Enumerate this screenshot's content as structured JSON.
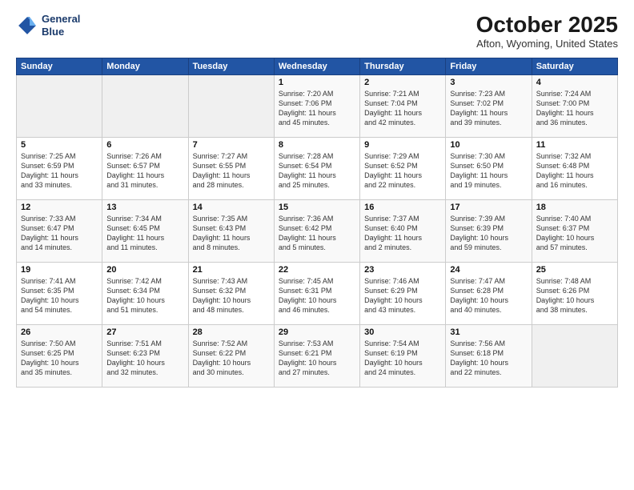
{
  "header": {
    "logo_line1": "General",
    "logo_line2": "Blue",
    "month": "October 2025",
    "location": "Afton, Wyoming, United States"
  },
  "weekdays": [
    "Sunday",
    "Monday",
    "Tuesday",
    "Wednesday",
    "Thursday",
    "Friday",
    "Saturday"
  ],
  "weeks": [
    [
      {
        "day": "",
        "info": ""
      },
      {
        "day": "",
        "info": ""
      },
      {
        "day": "",
        "info": ""
      },
      {
        "day": "1",
        "info": "Sunrise: 7:20 AM\nSunset: 7:06 PM\nDaylight: 11 hours\nand 45 minutes."
      },
      {
        "day": "2",
        "info": "Sunrise: 7:21 AM\nSunset: 7:04 PM\nDaylight: 11 hours\nand 42 minutes."
      },
      {
        "day": "3",
        "info": "Sunrise: 7:23 AM\nSunset: 7:02 PM\nDaylight: 11 hours\nand 39 minutes."
      },
      {
        "day": "4",
        "info": "Sunrise: 7:24 AM\nSunset: 7:00 PM\nDaylight: 11 hours\nand 36 minutes."
      }
    ],
    [
      {
        "day": "5",
        "info": "Sunrise: 7:25 AM\nSunset: 6:59 PM\nDaylight: 11 hours\nand 33 minutes."
      },
      {
        "day": "6",
        "info": "Sunrise: 7:26 AM\nSunset: 6:57 PM\nDaylight: 11 hours\nand 31 minutes."
      },
      {
        "day": "7",
        "info": "Sunrise: 7:27 AM\nSunset: 6:55 PM\nDaylight: 11 hours\nand 28 minutes."
      },
      {
        "day": "8",
        "info": "Sunrise: 7:28 AM\nSunset: 6:54 PM\nDaylight: 11 hours\nand 25 minutes."
      },
      {
        "day": "9",
        "info": "Sunrise: 7:29 AM\nSunset: 6:52 PM\nDaylight: 11 hours\nand 22 minutes."
      },
      {
        "day": "10",
        "info": "Sunrise: 7:30 AM\nSunset: 6:50 PM\nDaylight: 11 hours\nand 19 minutes."
      },
      {
        "day": "11",
        "info": "Sunrise: 7:32 AM\nSunset: 6:48 PM\nDaylight: 11 hours\nand 16 minutes."
      }
    ],
    [
      {
        "day": "12",
        "info": "Sunrise: 7:33 AM\nSunset: 6:47 PM\nDaylight: 11 hours\nand 14 minutes."
      },
      {
        "day": "13",
        "info": "Sunrise: 7:34 AM\nSunset: 6:45 PM\nDaylight: 11 hours\nand 11 minutes."
      },
      {
        "day": "14",
        "info": "Sunrise: 7:35 AM\nSunset: 6:43 PM\nDaylight: 11 hours\nand 8 minutes."
      },
      {
        "day": "15",
        "info": "Sunrise: 7:36 AM\nSunset: 6:42 PM\nDaylight: 11 hours\nand 5 minutes."
      },
      {
        "day": "16",
        "info": "Sunrise: 7:37 AM\nSunset: 6:40 PM\nDaylight: 11 hours\nand 2 minutes."
      },
      {
        "day": "17",
        "info": "Sunrise: 7:39 AM\nSunset: 6:39 PM\nDaylight: 10 hours\nand 59 minutes."
      },
      {
        "day": "18",
        "info": "Sunrise: 7:40 AM\nSunset: 6:37 PM\nDaylight: 10 hours\nand 57 minutes."
      }
    ],
    [
      {
        "day": "19",
        "info": "Sunrise: 7:41 AM\nSunset: 6:35 PM\nDaylight: 10 hours\nand 54 minutes."
      },
      {
        "day": "20",
        "info": "Sunrise: 7:42 AM\nSunset: 6:34 PM\nDaylight: 10 hours\nand 51 minutes."
      },
      {
        "day": "21",
        "info": "Sunrise: 7:43 AM\nSunset: 6:32 PM\nDaylight: 10 hours\nand 48 minutes."
      },
      {
        "day": "22",
        "info": "Sunrise: 7:45 AM\nSunset: 6:31 PM\nDaylight: 10 hours\nand 46 minutes."
      },
      {
        "day": "23",
        "info": "Sunrise: 7:46 AM\nSunset: 6:29 PM\nDaylight: 10 hours\nand 43 minutes."
      },
      {
        "day": "24",
        "info": "Sunrise: 7:47 AM\nSunset: 6:28 PM\nDaylight: 10 hours\nand 40 minutes."
      },
      {
        "day": "25",
        "info": "Sunrise: 7:48 AM\nSunset: 6:26 PM\nDaylight: 10 hours\nand 38 minutes."
      }
    ],
    [
      {
        "day": "26",
        "info": "Sunrise: 7:50 AM\nSunset: 6:25 PM\nDaylight: 10 hours\nand 35 minutes."
      },
      {
        "day": "27",
        "info": "Sunrise: 7:51 AM\nSunset: 6:23 PM\nDaylight: 10 hours\nand 32 minutes."
      },
      {
        "day": "28",
        "info": "Sunrise: 7:52 AM\nSunset: 6:22 PM\nDaylight: 10 hours\nand 30 minutes."
      },
      {
        "day": "29",
        "info": "Sunrise: 7:53 AM\nSunset: 6:21 PM\nDaylight: 10 hours\nand 27 minutes."
      },
      {
        "day": "30",
        "info": "Sunrise: 7:54 AM\nSunset: 6:19 PM\nDaylight: 10 hours\nand 24 minutes."
      },
      {
        "day": "31",
        "info": "Sunrise: 7:56 AM\nSunset: 6:18 PM\nDaylight: 10 hours\nand 22 minutes."
      },
      {
        "day": "",
        "info": ""
      }
    ]
  ]
}
